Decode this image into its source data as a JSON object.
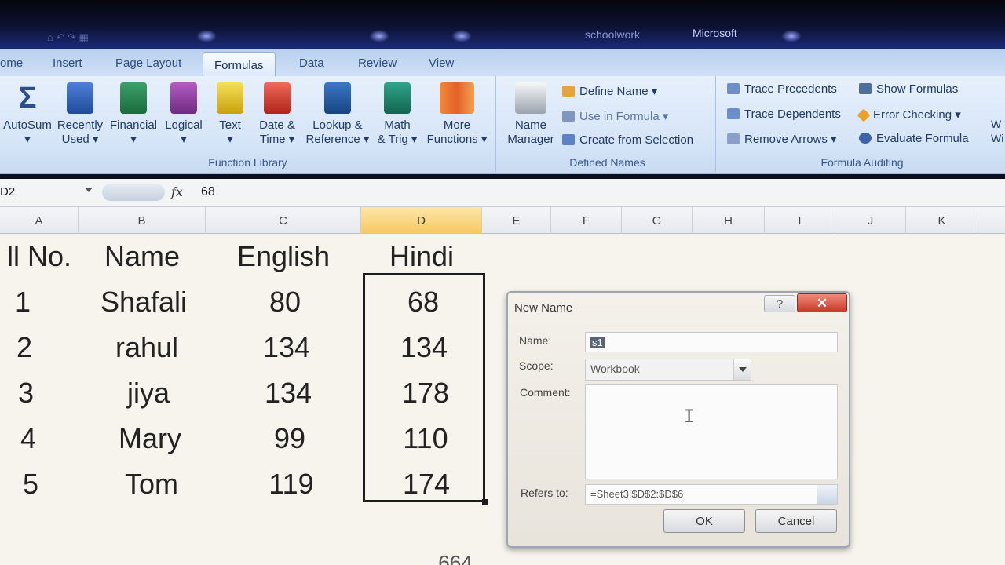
{
  "titlebar": {
    "doc_title": "schoolwork",
    "app_title": "Microsoft",
    "qat": "⌂ ↶ ↷ ▦"
  },
  "tabs": [
    {
      "label": "ome"
    },
    {
      "label": "Insert"
    },
    {
      "label": "Page Layout"
    },
    {
      "label": "Formulas"
    },
    {
      "label": "Data"
    },
    {
      "label": "Review"
    },
    {
      "label": "View"
    }
  ],
  "ribbon": {
    "function_library": {
      "label": "Function Library",
      "buttons": [
        {
          "l1": "AutoSum",
          "l2": "▾",
          "icon": "sigma-icon"
        },
        {
          "l1": "Recently",
          "l2": "Used ▾",
          "icon": "book-star-icon"
        },
        {
          "l1": "Financial",
          "l2": "▾",
          "icon": "book-money-icon"
        },
        {
          "l1": "Logical",
          "l2": "▾",
          "icon": "book-question-icon"
        },
        {
          "l1": "Text",
          "l2": "▾",
          "icon": "book-text-icon"
        },
        {
          "l1": "Date &",
          "l2": "Time ▾",
          "icon": "book-calendar-icon"
        },
        {
          "l1": "Lookup &",
          "l2": "Reference ▾",
          "icon": "book-magnifier-icon"
        },
        {
          "l1": "Math",
          "l2": "& Trig ▾",
          "icon": "book-theta-icon"
        },
        {
          "l1": "More",
          "l2": "Functions ▾",
          "icon": "books-stack-icon"
        }
      ]
    },
    "defined_names": {
      "label": "Defined Names",
      "name_manager": {
        "l1": "Name",
        "l2": "Manager"
      },
      "define_name": "Define Name ▾",
      "use_in_formula": "Use in Formula ▾",
      "create_from_selection": "Create from Selection"
    },
    "formula_auditing": {
      "label": "Formula Auditing",
      "trace_precedents": "Trace Precedents",
      "trace_dependents": "Trace Dependents",
      "remove_arrows": "Remove Arrows ▾",
      "show_formulas": "Show Formulas",
      "error_checking": "Error Checking ▾",
      "evaluate_formula": "Evaluate Formula",
      "clipped": "W\nWi"
    }
  },
  "formula_bar": {
    "name_box": "D2",
    "fx": "fx",
    "value": "68"
  },
  "columns": [
    "A",
    "B",
    "C",
    "D",
    "E",
    "F",
    "G",
    "H",
    "I",
    "J",
    "K"
  ],
  "sheet": {
    "header": [
      "ll No.",
      "Name",
      "English",
      "Hindi"
    ],
    "rows": [
      [
        "1",
        "Shafali",
        "80",
        "68"
      ],
      [
        "2",
        "rahul",
        "134",
        "134"
      ],
      [
        "3",
        "jiya",
        "134",
        "178"
      ],
      [
        "4",
        "Mary",
        "99",
        "110"
      ],
      [
        "5",
        "Tom",
        "119",
        "174"
      ]
    ],
    "partial_bottom": "664"
  },
  "dialog": {
    "title": "New Name",
    "help": "?",
    "close": "✕",
    "name_label": "Name:",
    "name_value": "s1",
    "scope_label": "Scope:",
    "scope_value": "Workbook",
    "comment_label": "Comment:",
    "refers_label": "Refers to:",
    "refers_value": "=Sheet3!$D$2:$D$6",
    "ok": "OK",
    "cancel": "Cancel"
  },
  "colors": {
    "selected_col": "#f6c860",
    "ribbon": "#dbe8f8",
    "close": "#c8392a"
  }
}
